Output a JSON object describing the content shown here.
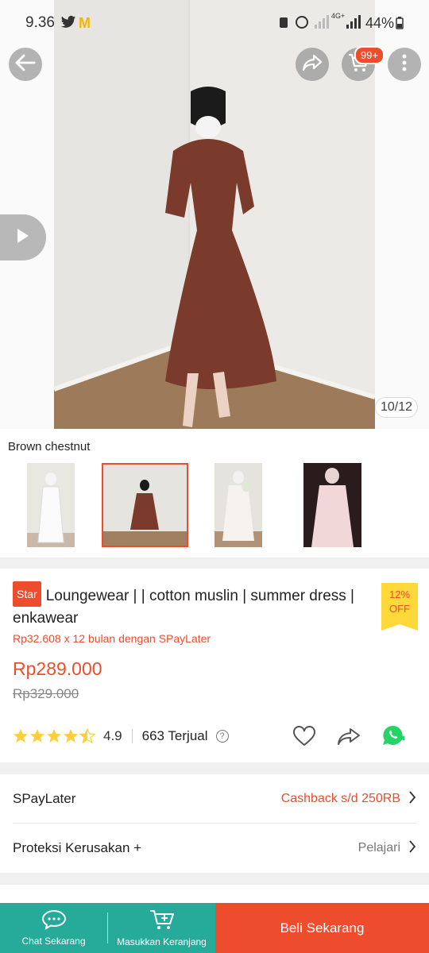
{
  "status_bar": {
    "time": "9.36",
    "battery": "44%",
    "network": "4G+"
  },
  "hero": {
    "image_counter": "10/12",
    "cart_badge": "99+"
  },
  "variants": {
    "selected_name": "Brown chestnut",
    "thumbnails": [
      "white-dress",
      "brown-chestnut-dress",
      "floral-white-dress",
      "pink-dress"
    ]
  },
  "product": {
    "tag": "Star",
    "title": "Loungewear | | cotton muslin | summer dress | enkawear",
    "discount_pct": "12%",
    "discount_label": "OFF",
    "paylater_line": "Rp32.608 x 12 bulan dengan SPayLater",
    "price": "Rp289.000",
    "old_price": "Rp329.000",
    "rating": "4.9",
    "rating_stars": 4.5,
    "sold": "663 Terjual"
  },
  "rows": [
    {
      "label": "SPayLater",
      "value": "Cashback s/d 250RB"
    },
    {
      "label": "Proteksi Kerusakan +",
      "value": "Pelajari"
    }
  ],
  "bottom_bar": {
    "chat_label": "Chat Sekarang",
    "cart_label": "Masukkan Keranjang",
    "buy_label": "Beli Sekarang"
  },
  "colors": {
    "primary": "#ee4d2d",
    "teal": "#26aa99",
    "star": "#ffce3d",
    "whatsapp": "#25d366"
  }
}
